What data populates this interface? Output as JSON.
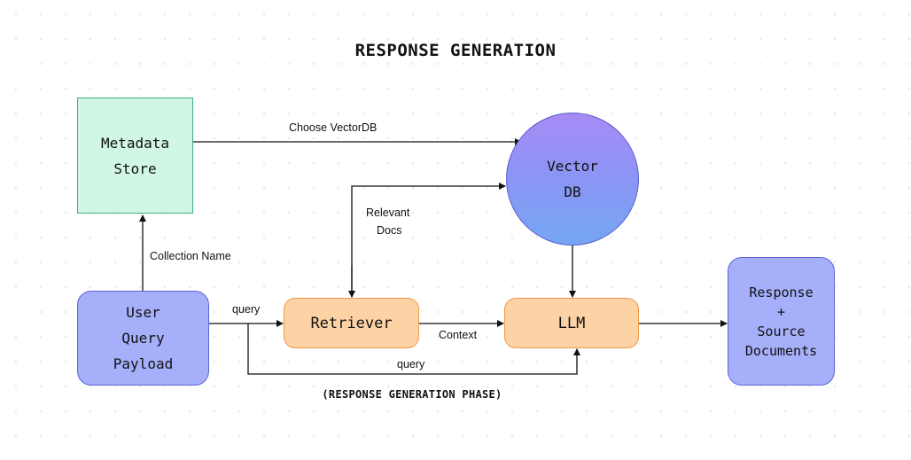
{
  "title": "RESPONSE GENERATION",
  "phase_label": "(RESPONSE GENERATION PHASE)",
  "nodes": {
    "metadata_store": {
      "label": "Metadata\nStore",
      "color": "#d1f7e4",
      "border": "#3fae84",
      "shape": "square"
    },
    "vector_db": {
      "label": "Vector\nDB",
      "gradient": [
        "#a98af5",
        "#75a7f3"
      ],
      "shape": "circle"
    },
    "user_query": {
      "label": "User\nQuery\nPayload",
      "color": "#a6aff9",
      "shape": "rounded-rect"
    },
    "retriever": {
      "label": "Retriever",
      "color": "#fdd3a6",
      "shape": "rounded-rect"
    },
    "llm": {
      "label": "LLM",
      "color": "#fdd3a6",
      "shape": "rounded-rect"
    },
    "response": {
      "label": "Response\n+\nSource\nDocuments",
      "color": "#a6aff9",
      "shape": "rounded-rect"
    }
  },
  "edges": [
    {
      "from": "metadata_store",
      "to": "vector_db",
      "label": "Choose VectorDB"
    },
    {
      "from": "user_query",
      "to": "metadata_store",
      "label": "Collection Name"
    },
    {
      "from": "retriever",
      "to": "vector_db",
      "label": "Relevant\nDocs",
      "bidirectional": true
    },
    {
      "from": "user_query",
      "to": "retriever",
      "label": "query"
    },
    {
      "from": "retriever",
      "to": "llm",
      "label": "Context"
    },
    {
      "from": "user_query",
      "to": "llm",
      "label": "query"
    },
    {
      "from": "vector_db",
      "to": "llm",
      "label": ""
    },
    {
      "from": "llm",
      "to": "response",
      "label": ""
    }
  ],
  "edge_labels": {
    "choose_vectordb": "Choose VectorDB",
    "collection_name": "Collection Name",
    "relevant_docs_1": "Relevant",
    "relevant_docs_2": "Docs",
    "query_top": "query",
    "context": "Context",
    "query_bottom": "query"
  }
}
